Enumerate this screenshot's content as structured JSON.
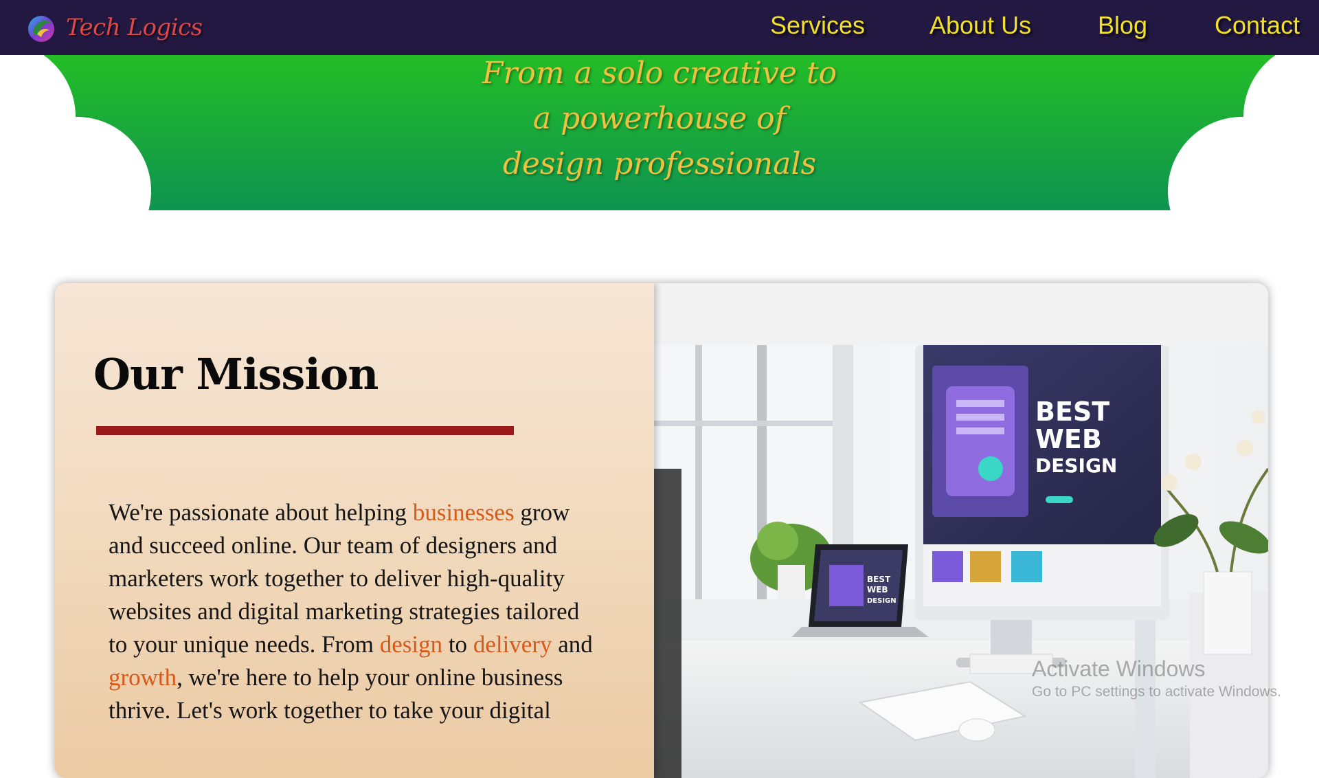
{
  "navbar": {
    "brand_name": "Tech Logics",
    "brand_icon": "bird-logo-icon",
    "items": [
      {
        "label": "Services"
      },
      {
        "label": "About Us"
      },
      {
        "label": "Blog"
      },
      {
        "label": "Contact"
      }
    ]
  },
  "hero": {
    "lines": [
      "From a solo creative to",
      "a powerhouse of",
      "design professionals"
    ]
  },
  "mission": {
    "title": "Our Mission",
    "segments": [
      {
        "text": "We're passionate about helping ",
        "highlight": false
      },
      {
        "text": "businesses",
        "highlight": true
      },
      {
        "text": " grow and succeed online. Our team of designers and marketers work together to deliver high-quality websites and digital marketing strategies tailored to your unique needs. From ",
        "highlight": false
      },
      {
        "text": "design",
        "highlight": true
      },
      {
        "text": " to ",
        "highlight": false
      },
      {
        "text": "delivery",
        "highlight": true
      },
      {
        "text": " and ",
        "highlight": false
      },
      {
        "text": "growth",
        "highlight": true
      },
      {
        "text": ", we're here to help your online business thrive. Let's work together to take your digital",
        "highlight": false
      }
    ],
    "image_text": {
      "screen_line1": "BEST",
      "screen_line2": "WEB",
      "screen_line3": "DESIGN"
    }
  },
  "watermark": {
    "title": "Activate Windows",
    "subtitle": "Go to PC settings to activate Windows."
  },
  "colors": {
    "navbar_bg": "#231841",
    "nav_text": "#f0e02a",
    "brand_text": "#e04848",
    "hero_gradient_top": "#24bd26",
    "hero_gradient_bottom": "#0e9350",
    "hero_text": "#f0c040",
    "mission_rule": "#9c1a1a",
    "highlight_text": "#d85a1a"
  }
}
